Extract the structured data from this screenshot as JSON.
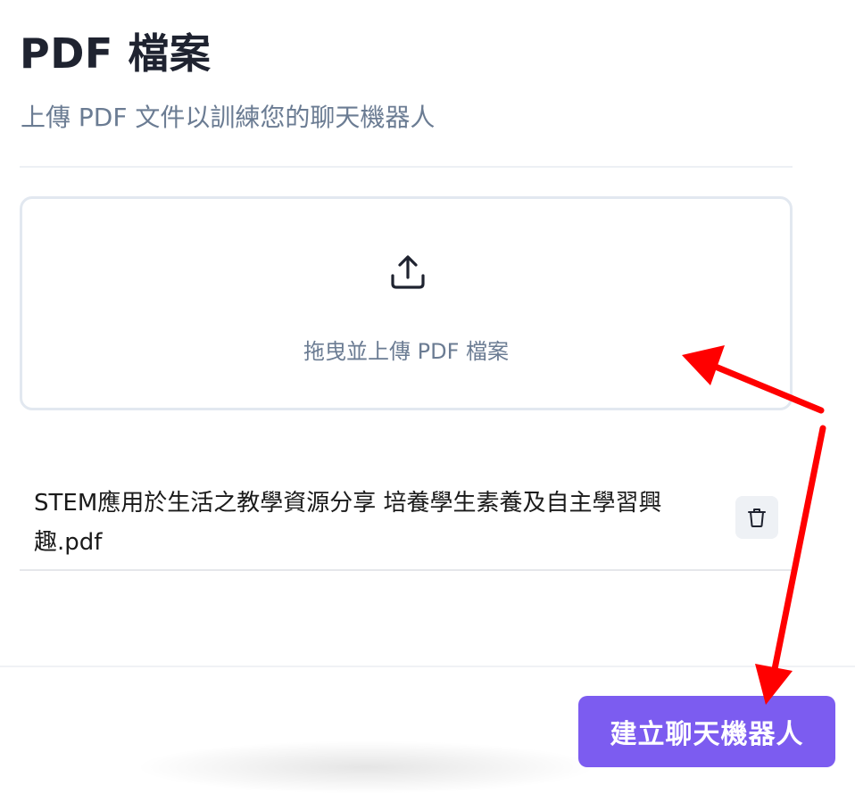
{
  "header": {
    "title": "PDF 檔案",
    "subtitle": "上傳 PDF 文件以訓練您的聊天機器人"
  },
  "dropzone": {
    "icon": "upload-icon",
    "label": "拖曳並上傳 PDF 檔案"
  },
  "files": [
    {
      "name": "STEM應用於生活之教學資源分享 培養學生素養及自主學習興趣.pdf",
      "action_icon": "trash-icon"
    }
  ],
  "footer": {
    "create_button_label": "建立聊天機器人"
  },
  "colors": {
    "accent": "#7c5cf0",
    "annotation_arrow": "#ff0000",
    "muted_text": "#6b7c93"
  }
}
